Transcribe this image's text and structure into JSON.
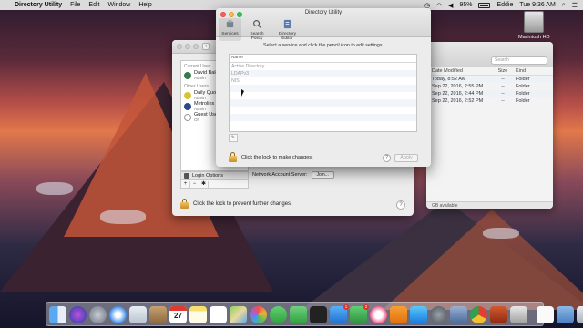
{
  "menubar": {
    "app_name": "Directory Utility",
    "menus": [
      "File",
      "Edit",
      "Window",
      "Help"
    ],
    "battery": "95%",
    "user": "Eddie",
    "clock": "Tue 9:36 AM"
  },
  "desktop": {
    "hd_label": "Macintosh HD"
  },
  "finder": {
    "search_placeholder": "Search",
    "columns": [
      "Date Modified",
      "Size",
      "Kind"
    ],
    "rows": [
      {
        "date": "Today, 8:52 AM",
        "size": "--",
        "kind": "Folder"
      },
      {
        "date": "Sep 22, 2016, 2:55 PM",
        "size": "--",
        "kind": "Folder"
      },
      {
        "date": "Sep 22, 2016, 2:44 PM",
        "size": "--",
        "kind": "Folder"
      },
      {
        "date": "Sep 22, 2016, 2:52 PM",
        "size": "--",
        "kind": "Folder"
      }
    ],
    "footer": "GB available"
  },
  "users": {
    "back_glyph": "‹",
    "current_user_header": "Current User",
    "other_users_header": "Other Users",
    "current_user": {
      "name": "David Balo",
      "role": "Admin",
      "color": "#3a7a4a"
    },
    "other_users": [
      {
        "name": "Daily Quo",
        "role": "Admin",
        "color": "#d8c23a"
      },
      {
        "name": "Metrolinx",
        "role": "Admin",
        "color": "#2a4a8a"
      },
      {
        "name": "Guest User",
        "role": "Off",
        "color": "#ffffff"
      }
    ],
    "login_options": "Login Options",
    "plus": "+",
    "minus": "−",
    "gear": "✱",
    "network_account_server": "Network Account Server:",
    "join_button": "Join...",
    "lock_text": "Click the lock to prevent further changes.",
    "help": "?"
  },
  "directory_utility": {
    "title": "Directory Utility",
    "tabs": [
      {
        "label": "Services",
        "icon": "services-icon"
      },
      {
        "label": "Search Policy",
        "icon": "search-policy-icon"
      },
      {
        "label": "Directory Editor",
        "icon": "directory-editor-icon"
      }
    ],
    "instruction": "Select a service and click the pencil icon to edit settings.",
    "services_header": "Name",
    "services": [
      "Active Directory",
      "LDAPv3",
      "NIS"
    ],
    "pencil": "✎",
    "lock_text": "Click the lock to make changes.",
    "help": "?",
    "apply": "Apply"
  },
  "dock": {
    "calendar_day": "27",
    "mail_badge": "1",
    "notes_badge": "2",
    "apps": [
      "finder",
      "siri",
      "launchpad",
      "safari",
      "mail",
      "contacts",
      "calendar",
      "notes",
      "reminders",
      "maps",
      "photos",
      "messages",
      "facetime",
      "itunes",
      "ibooks",
      "app-store",
      "system-preferences",
      "directory-utility",
      "terminal",
      "trash"
    ]
  },
  "colors": {
    "accent": "#3b7de0",
    "lock_gold": "#e0a83a"
  }
}
